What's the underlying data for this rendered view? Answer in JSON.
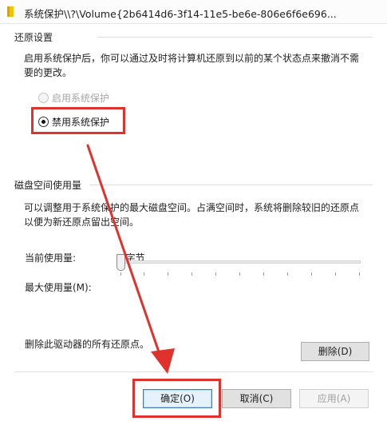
{
  "window": {
    "title": "系统保护\\\\?\\Volume{2b6414d6-3f14-11e5-be6e-806e6f6e696..."
  },
  "restore": {
    "heading": "还原设置",
    "description_line1": "启用系统保护后，你可以通过及时将计算机还原到以前的某个状态点来撤消不需",
    "description_line2": "要的更改。",
    "option_enable": "启用系统保护",
    "option_disable": "禁用系统保护",
    "selected": "禁用系统保护"
  },
  "disk": {
    "heading": "磁盘空间使用量",
    "description_line1": "可以调整用于系统保护的最大磁盘空间。占满空间时，系统将删除较旧的还原点",
    "description_line2": "以便为新还原点留出空间。",
    "current_label": "当前使用量:",
    "current_value": "0 字节",
    "max_label": "最大使用量(M):",
    "slider_value": 0
  },
  "delete": {
    "text": "删除此驱动器的所有还原点。",
    "button": "删除(D)"
  },
  "buttons": {
    "ok": "确定(O)",
    "cancel": "取消(C)",
    "apply": "应用(A)"
  },
  "colors": {
    "annotation_red": "#e0322c",
    "accent_blue": "#3c7fb1"
  }
}
